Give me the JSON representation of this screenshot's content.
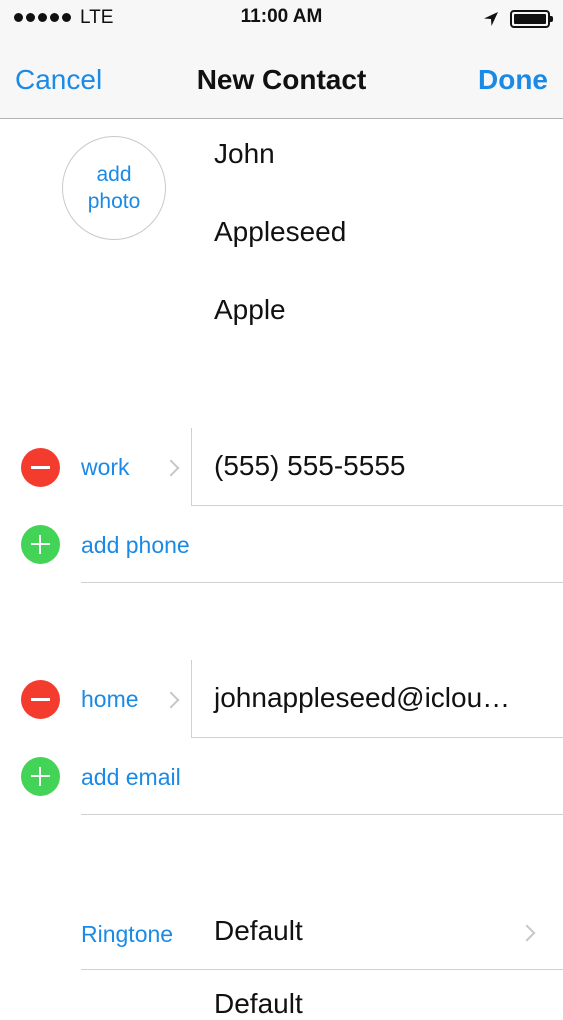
{
  "status_bar": {
    "carrier": "LTE",
    "time": "11:00 AM"
  },
  "nav": {
    "cancel": "Cancel",
    "title": "New Contact",
    "done": "Done"
  },
  "photo": {
    "line1": "add",
    "line2": "photo"
  },
  "name_fields": {
    "first": "John",
    "last": "Appleseed",
    "company": "Apple"
  },
  "phone": {
    "label": "work",
    "value": "(555) 555-5555",
    "add_label": "add phone"
  },
  "email": {
    "label": "home",
    "value": "johnappleseed@iclou…",
    "add_label": "add email"
  },
  "ringtone": {
    "label": "Ringtone",
    "value": "Default",
    "next_value": "Default"
  },
  "icons": {
    "signal": "signal-dots-icon",
    "location": "location-arrow-icon",
    "battery": "battery-icon",
    "remove": "minus-circle-icon",
    "add": "plus-circle-icon",
    "disclosure": "chevron-right-icon"
  },
  "colors": {
    "accent": "#1a8ae6",
    "delete": "#f43c2e",
    "add": "#43d356"
  }
}
